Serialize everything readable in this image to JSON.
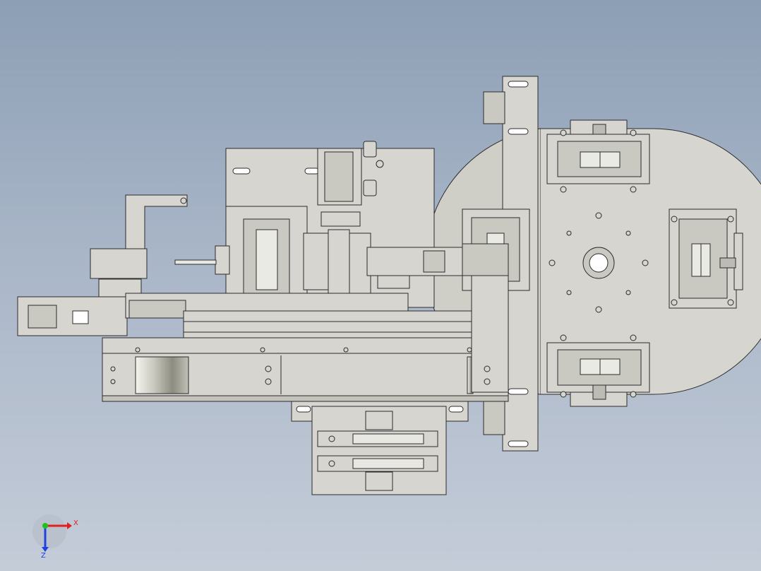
{
  "viewport": {
    "background_top": "#8d9fb5",
    "background_bottom": "#c4ccd8"
  },
  "model": {
    "part_color": "#d6d5cf",
    "part_shade": "#c3c2bb",
    "edge_color": "#2c2c2c"
  },
  "triad": {
    "x_label": "X",
    "z_label": "Z",
    "x_color": "#e02020",
    "y_color": "#20c020",
    "z_color": "#2040e0"
  }
}
